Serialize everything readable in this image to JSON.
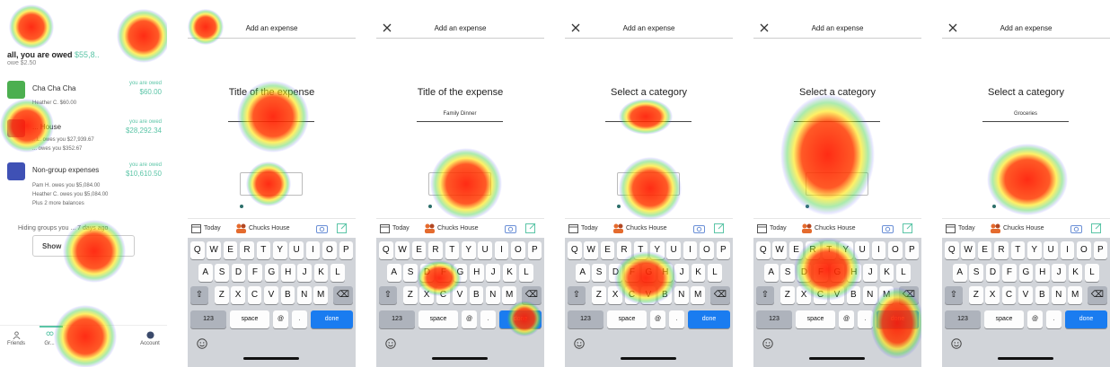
{
  "colors": {
    "accent": "#5bc5a7",
    "keyboard_bg": "#d1d4d9",
    "done_blue": "#1a7cf0",
    "heat_hot": "#ff1a00",
    "heat_warm": "#ffe600",
    "heat_cool": "#46d24a"
  },
  "group_list": {
    "summary_prefix": "all, you are owed",
    "summary_amount": "$55,8..",
    "summary_sub": "owe $2.50",
    "groups": [
      {
        "name": "Cha Cha Cha",
        "owed_label": "you are owed",
        "owed_amount": "$60.00",
        "lines": [
          "Heather C. $60.00"
        ],
        "icon_color": "#4caf50"
      },
      {
        "name": "... House",
        "owed_label": "you are owed",
        "owed_amount": "$28,292.34",
        "lines": [
          "...L. owes you $27,939.67",
          "... owes you $352.67"
        ],
        "icon_color": "#9c27b0"
      },
      {
        "name": "Non-group expenses",
        "owed_label": "you are owed",
        "owed_amount": "$10,610.50",
        "lines": [
          "Pam H. owes you $5,084.00",
          "Heather C. owes you $5,084.00",
          "Plus 2 more balances"
        ],
        "icon_color": "#3f51b5"
      }
    ],
    "hiding_text": "Hiding groups you ... 7 days ago",
    "show_button": "Show",
    "tabs": [
      {
        "label": "Friends",
        "icon": "person-icon"
      },
      {
        "label": "Gr...",
        "icon": "group-icon"
      },
      {
        "label": "Account",
        "icon": "avatar-icon"
      }
    ]
  },
  "screens": [
    {
      "title": "Add an expense",
      "show_close": false,
      "label": "Title of the expense",
      "input_value": ""
    },
    {
      "title": "Add an expense",
      "show_close": true,
      "label": "Title of the expense",
      "input_value": "Family Dinner"
    },
    {
      "title": "Add an expense",
      "show_close": true,
      "label": "Select a category",
      "input_value": ""
    },
    {
      "title": "Add an expense",
      "show_close": true,
      "label": "Select a category",
      "input_value": ""
    },
    {
      "title": "Add an expense",
      "show_close": true,
      "label": "Select a category",
      "input_value": "Groceries"
    }
  ],
  "accessory": {
    "today": "Today",
    "group": "Chucks House"
  },
  "keyboard": {
    "row1": [
      "Q",
      "W",
      "E",
      "R",
      "T",
      "Y",
      "U",
      "I",
      "O",
      "P"
    ],
    "row2": [
      "A",
      "S",
      "D",
      "F",
      "G",
      "H",
      "J",
      "K",
      "L"
    ],
    "row3": [
      "Z",
      "X",
      "C",
      "V",
      "B",
      "N",
      "M"
    ],
    "num_key": "123",
    "space_key": "space",
    "at_key": "@",
    "dot_key": ".",
    "done_key": "done"
  }
}
